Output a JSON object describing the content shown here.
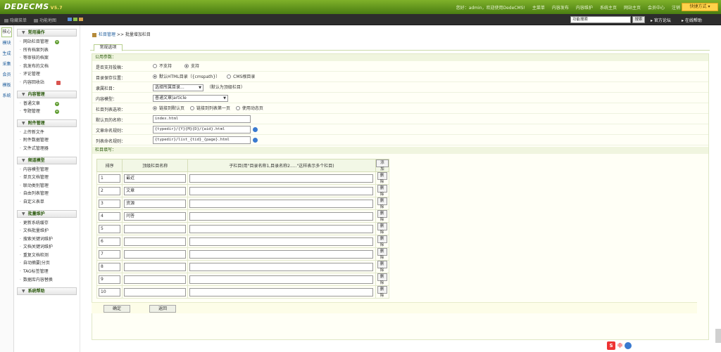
{
  "header": {
    "logo": "DEDECMS",
    "version": "V5.7",
    "nav": [
      "您好：admin，欢迎使用DedeCMS!",
      "主菜单",
      "内容发布",
      "内容维护",
      "系统主页",
      "网站主页",
      "会员中心",
      "注销"
    ],
    "quick_menu": "快捷方式 ▾"
  },
  "subbar": {
    "hide_menu": "隐藏菜单",
    "function_map": "功能地图",
    "search_value": "功能搜索",
    "search_button": "搜索",
    "forum": "官方论坛",
    "help": "在线帮助",
    "colors": [
      "#5a8fd6",
      "#8cc04a",
      "#d6a24a"
    ]
  },
  "vtabs": [
    "核心",
    "模块",
    "生成",
    "采集",
    "会员",
    "模板",
    "系统"
  ],
  "sidebar": {
    "groups": [
      {
        "title": "常用操作",
        "items": [
          "网站栏目管理",
          "所有档案列表",
          "等审核的档案",
          "我发布的文档",
          "评论管理",
          "内容回收站"
        ]
      },
      {
        "title": "内容管理",
        "items": [
          "普通文章",
          "专题管理"
        ]
      },
      {
        "title": "附件管理",
        "items": [
          "上传新文件",
          "附件数据管理",
          "文件式管理器"
        ]
      },
      {
        "title": "频道模型",
        "items": [
          "内容模型管理",
          "单页文档管理",
          "联动类别管理",
          "自由列表管理",
          "自定义表单"
        ]
      },
      {
        "title": "批量维护",
        "items": [
          "更新系统缓存",
          "文档批量维护",
          "搜索关键词维护",
          "文档关键词维护",
          "重复文档检测",
          "自动摘要|分页",
          "TAG标签管理",
          "数据库内容替换"
        ]
      },
      {
        "title": "系统帮助",
        "items": []
      }
    ]
  },
  "main": {
    "breadcrumb_link": "栏目管理",
    "breadcrumb_current": " >> 批量增加栏目",
    "tab": "常规选项",
    "section_common": "公用参数：",
    "rows": {
      "allow_post_label": "是否支持投稿：",
      "allow_post_opt1": "不支持",
      "allow_post_opt2": "支持",
      "save_pos_label": "目录保存位置：",
      "save_pos_opt1": "默认HTML目录（{cmspath}）",
      "save_pos_opt2": "CMS根目录",
      "parent_label": "隶属栏目：",
      "parent_select": "选择所属目录...",
      "parent_note": "（默认为顶级栏目）",
      "model_label": "内容模型：",
      "model_select": "普通文章|article",
      "list_opt_label": "栏目列表选项：",
      "list_opt1": "链接到默认页",
      "list_opt2": "链接到列表第一页",
      "list_opt3": "使用动态页",
      "default_page_label": "默认页的名称：",
      "default_page_value": "index.html",
      "article_rule_label": "文章命名规则：",
      "article_rule_value": "{typedir}/{Y}{M}{D}/{aid}.html",
      "list_rule_label": "列表命名规则：",
      "list_rule_value": "{typedir}/list_{tid}_{page}.html"
    },
    "section_fill": "栏目填写：",
    "table": {
      "headers": [
        "排序",
        "顶级栏目名称",
        "子栏目(用\"目录名称1,目录名称2.....\"这样表示多个栏目)"
      ],
      "add_btn": "添加",
      "delete_btn": "删除",
      "rows": [
        {
          "order": "1",
          "name": "最近"
        },
        {
          "order": "2",
          "name": "文章"
        },
        {
          "order": "3",
          "name": "资源"
        },
        {
          "order": "4",
          "name": "问答"
        },
        {
          "order": "5",
          "name": ""
        },
        {
          "order": "6",
          "name": ""
        },
        {
          "order": "7",
          "name": ""
        },
        {
          "order": "8",
          "name": ""
        },
        {
          "order": "9",
          "name": ""
        },
        {
          "order": "10",
          "name": ""
        }
      ]
    },
    "confirm_btn": "确定",
    "back_btn": "返回"
  },
  "ime": {
    "brand": "S",
    "lang": "中"
  }
}
